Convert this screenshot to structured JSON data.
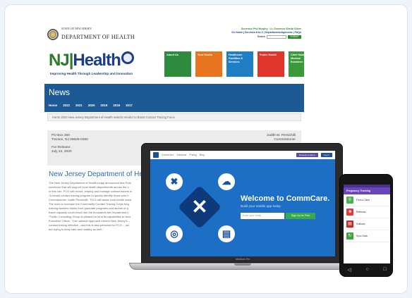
{
  "website": {
    "department_small": "STATE OF NEW JERSEY",
    "department_name": "DEPARTMENT OF HEALTH",
    "governor_line": "Governor Phil Murphy",
    "lt_governor_line": "Lt. Governor Sheila Oliver",
    "links_line": "NJ Home | Services A to Z | Departments/Agencies | FAQs",
    "search_label": "Search",
    "search_button": "SUBMIT",
    "logo_nj": "NJ",
    "logo_health": "Health",
    "tagline": "Improving Health Through Leadership and Innovation",
    "tiles": [
      {
        "label": "About Us",
        "color": "#2e8b3e"
      },
      {
        "label": "Your Health",
        "color": "#e8741e"
      },
      {
        "label": "Healthcare Facilities & Services",
        "color": "#1f7ec4"
      },
      {
        "label": "Public Health",
        "color": "#e0352b"
      },
      {
        "label": "Chief State Medical Examiner",
        "color": "#3a9a3a"
      }
    ],
    "news_title": "News",
    "news_nav": [
      "Home",
      "2022",
      "2021",
      "2020",
      "2019",
      "2018",
      "2017"
    ],
    "breadcrumb": "Home  2020  New Jersey Department of Health Selects Vendor to Boost Contact Tracing Force",
    "address_left": [
      "PO Box 360",
      "Trenton, NJ 08625-0360"
    ],
    "address_right": [
      "Judith M. Persichilli",
      "Commissioner"
    ],
    "release_label": "For Release:",
    "release_date": "July 24, 2020",
    "article_title": "New Jersey Department of Health Sele",
    "article_lines": [
      "The New Jersey Department of Health today announced that Publ",
      "workforce that will support local health departments across the s",
      "In this role, PCG will recruit, employ and manage contact tracers w",
      "\"A robust contact tracing program to quickly identify those who h",
      "Commissioner Judith Persichilli. \"PCG will assist local health depa",
      "The work to increase the Community Contact Tracing Corps beg",
      "training workers drawn from graduate programs and alumni of g",
      "tracer capacity could reach into the thousands the Department s",
      "\"Public Consulting Group is pleased to lend its capabilities to New",
      "Executive Officer. \"Our national approach mirrors New Jersey's --",
      "contact tracing effective - and this is also personal for PCG -- we",
      "are trying to keep safe and healthy as well.\""
    ]
  },
  "laptop_app": {
    "nav": [
      "CommCare",
      "Solutions",
      "Pricing",
      "Blog"
    ],
    "login_label": "Log In",
    "signup_top_label": "Sign Up",
    "demo_label": "Request a Demo",
    "welcome": "Welcome to CommCare.",
    "welcome_sub": "Build your mobile app today",
    "email_placeholder": "Enter your email",
    "signup_label": "Sign Up for Free",
    "hero_icons": [
      "wrench-icon",
      "cloud-icon",
      "target-icon",
      "chart-icon"
    ],
    "brand": "MacBook Pro"
  },
  "phone_app": {
    "title": "Pregnancy Tracking",
    "items": [
      {
        "label": "Find a Client",
        "color": "#4caf50",
        "icon": "search-icon"
      },
      {
        "label": "Referrals",
        "color": "#e53935",
        "icon": "referral-icon"
      },
      {
        "label": "Outlines",
        "color": "#c62828",
        "icon": "outline-icon"
      },
      {
        "label": "Sync Data",
        "color": "#43a047",
        "icon": "sync-icon"
      }
    ]
  }
}
